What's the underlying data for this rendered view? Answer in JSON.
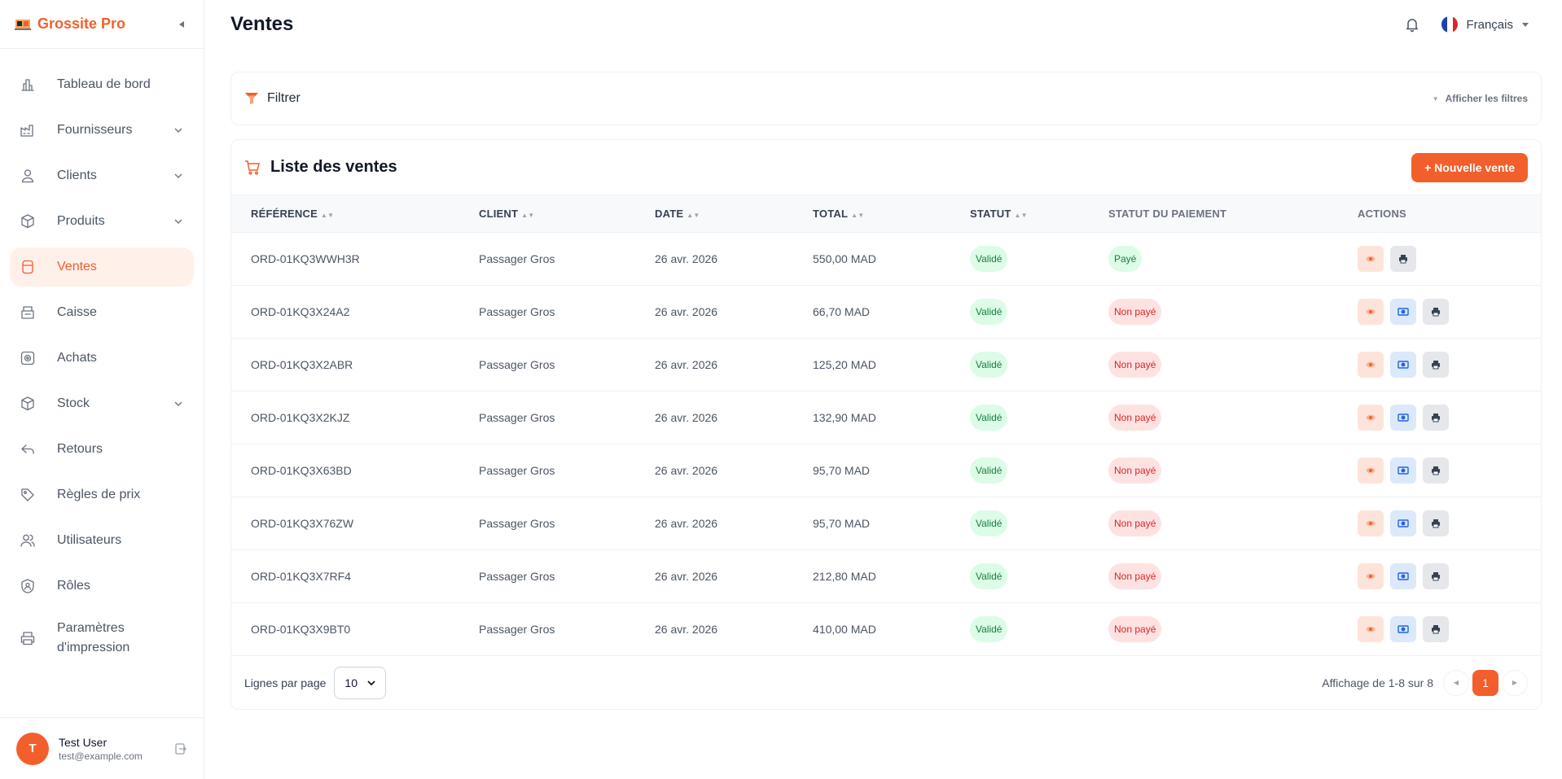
{
  "app": {
    "name": "Grossite Pro",
    "colors": {
      "accent": "#f25f2c",
      "success": "#15803d",
      "danger": "#dc2626"
    }
  },
  "sidebar": {
    "items": [
      {
        "label": "Tableau de bord",
        "icon": "chart-bars-icon"
      },
      {
        "label": "Fournisseurs",
        "icon": "factory-icon",
        "expandable": true
      },
      {
        "label": "Clients",
        "icon": "user-icon",
        "expandable": true
      },
      {
        "label": "Produits",
        "icon": "box-icon",
        "expandable": true
      },
      {
        "label": "Ventes",
        "icon": "receipt-icon",
        "active": true
      },
      {
        "label": "Caisse",
        "icon": "cash-register-icon"
      },
      {
        "label": "Achats",
        "icon": "wallet-icon"
      },
      {
        "label": "Stock",
        "icon": "package-icon",
        "expandable": true
      },
      {
        "label": "Retours",
        "icon": "return-arrow-icon"
      },
      {
        "label": "Règles de prix",
        "icon": "tag-icon"
      },
      {
        "label": "Utilisateurs",
        "icon": "users-icon"
      },
      {
        "label": "Rôles",
        "icon": "shield-user-icon"
      },
      {
        "label": "Paramètres d'impression",
        "icon": "printer-icon"
      }
    ],
    "user": {
      "initial": "T",
      "name": "Test User",
      "email": "test@example.com"
    }
  },
  "header": {
    "title": "Ventes",
    "language": "Français"
  },
  "filter": {
    "title": "Filtrer",
    "toggle_label": "Afficher les filtres"
  },
  "sales": {
    "title": "Liste des ventes",
    "new_button": "+ Nouvelle vente",
    "columns": {
      "reference": "RÉFÉRENCE",
      "client": "CLIENT",
      "date": "DATE",
      "total": "TOTAL",
      "statut": "STATUT",
      "payment": "STATUT DU PAIEMENT",
      "actions": "ACTIONS"
    },
    "rows": [
      {
        "reference": "ORD-01KQ3WWH3R",
        "client": "Passager Gros",
        "date": "26 avr. 2026",
        "total": "550,00 MAD",
        "statut": "Validé",
        "payment": "Payé",
        "paid": true
      },
      {
        "reference": "ORD-01KQ3X24A2",
        "client": "Passager Gros",
        "date": "26 avr. 2026",
        "total": "66,70 MAD",
        "statut": "Validé",
        "payment": "Non payé",
        "paid": false
      },
      {
        "reference": "ORD-01KQ3X2ABR",
        "client": "Passager Gros",
        "date": "26 avr. 2026",
        "total": "125,20 MAD",
        "statut": "Validé",
        "payment": "Non payé",
        "paid": false
      },
      {
        "reference": "ORD-01KQ3X2KJZ",
        "client": "Passager Gros",
        "date": "26 avr. 2026",
        "total": "132,90 MAD",
        "statut": "Validé",
        "payment": "Non payé",
        "paid": false
      },
      {
        "reference": "ORD-01KQ3X63BD",
        "client": "Passager Gros",
        "date": "26 avr. 2026",
        "total": "95,70 MAD",
        "statut": "Validé",
        "payment": "Non payé",
        "paid": false
      },
      {
        "reference": "ORD-01KQ3X76ZW",
        "client": "Passager Gros",
        "date": "26 avr. 2026",
        "total": "95,70 MAD",
        "statut": "Validé",
        "payment": "Non payé",
        "paid": false
      },
      {
        "reference": "ORD-01KQ3X7RF4",
        "client": "Passager Gros",
        "date": "26 avr. 2026",
        "total": "212,80 MAD",
        "statut": "Validé",
        "payment": "Non payé",
        "paid": false
      },
      {
        "reference": "ORD-01KQ3X9BT0",
        "client": "Passager Gros",
        "date": "26 avr. 2026",
        "total": "410,00 MAD",
        "statut": "Validé",
        "payment": "Non payé",
        "paid": false
      }
    ]
  },
  "pagination": {
    "rows_label": "Lignes par page",
    "rows_per_page": "10",
    "showing": "Affichage de 1-8 sur 8",
    "current_page": "1"
  }
}
